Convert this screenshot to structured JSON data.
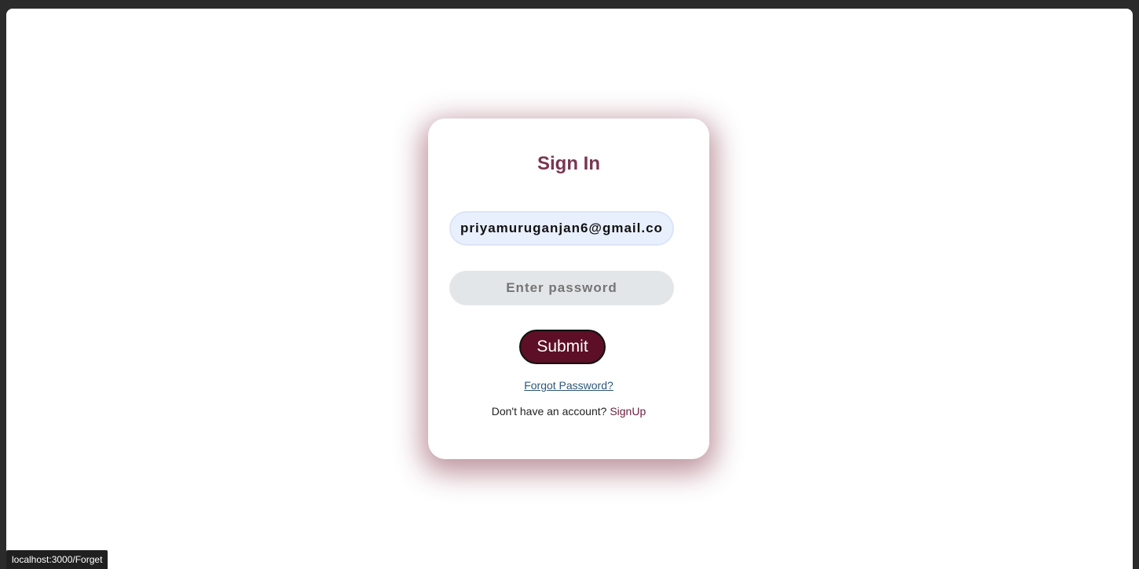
{
  "form": {
    "title": "Sign In",
    "email_value": "priyamuruganjan6@gmail.co",
    "password_placeholder": "Enter password",
    "submit_label": "Submit",
    "forgot_label": "Forgot Password?",
    "signup_prompt": "Don't have an account?",
    "signup_label": "SignUp"
  },
  "status_bar": {
    "url": "localhost:3000/Forget"
  },
  "colors": {
    "title": "#7a3550",
    "button": "#5c0f26",
    "card_shadow": "#6e142d",
    "link": "#2f5778",
    "signup_link": "#6b2140"
  }
}
